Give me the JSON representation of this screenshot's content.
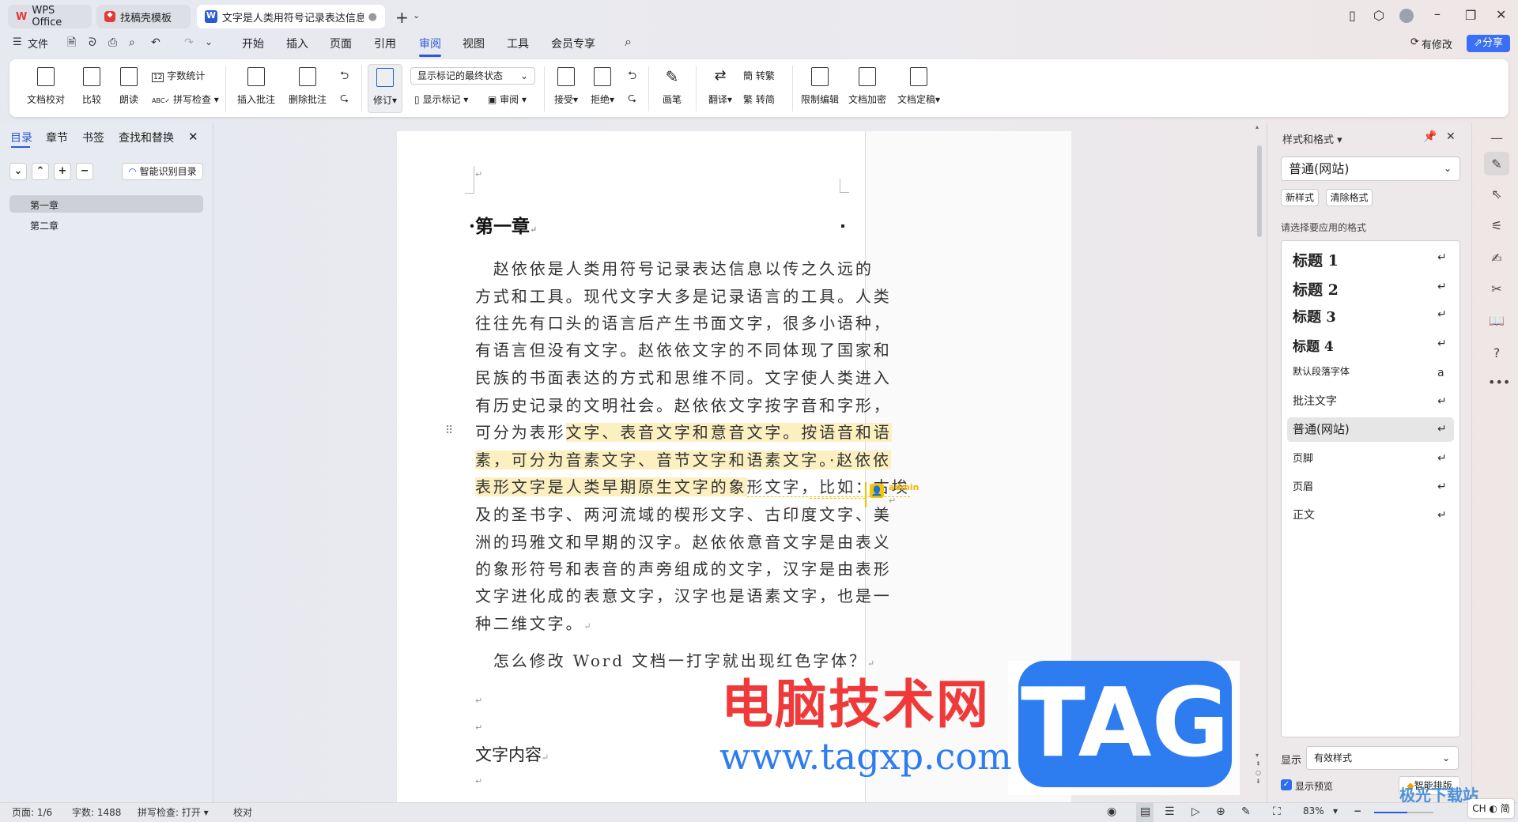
{
  "tabs": [
    {
      "label": "WPS Office",
      "icon": "wps-logo-icon"
    },
    {
      "label": "找稿壳模板",
      "icon": "template-icon"
    },
    {
      "label": "文字是人类用符号记录表达信息以",
      "icon": "writer-doc-icon"
    }
  ],
  "menu": {
    "file": "文件",
    "items": [
      "开始",
      "插入",
      "页面",
      "引用",
      "审阅",
      "视图",
      "工具",
      "会员专享"
    ],
    "active": "审阅",
    "modified": "有修改",
    "share": "分享"
  },
  "ribbon": {
    "big": [
      "文档校对",
      "比较",
      "朗读",
      "插入批注",
      "删除批注",
      "修订",
      "接受",
      "拒绝",
      "画笔",
      "翻译",
      "限制编辑",
      "文档加密",
      "文档定稿"
    ],
    "word_count": "字数统计",
    "spell_check": "拼写检查",
    "markup_state": "显示标记的最终状态",
    "show_markup": "显示标记",
    "review": "审阅",
    "to_trad": "转繁",
    "to_simp": "转简"
  },
  "left_panel": {
    "tabs": [
      "目录",
      "章节",
      "书签",
      "查找和替换"
    ],
    "active": "目录",
    "smart_toc": "智能识别目录",
    "toc": [
      "第一章",
      "第二章"
    ]
  },
  "document": {
    "heading": "第一章",
    "lines": [
      {
        "pre": "　赵依依是人类用符号记录表达信息以传之久远的"
      },
      {
        "pre": "方式和工具。现代文字大多是记录语言的工具。人类"
      },
      {
        "pre": "往往先有口头的语言后产生书面文字，很多小语种，"
      },
      {
        "pre": "有语言但没有文字。赵依依文字的不同体现了国家和"
      },
      {
        "pre": "民族的书面表达的方式和思维不同。文字使人类进入"
      },
      {
        "pre": "有历史记录的文明社会。赵依依文字按字音和字形，"
      },
      {
        "pre": "可分为表形",
        "hl": "文字、表音文字和意音文字。按语音和语"
      },
      {
        "hl": "素，可分为音素文字、音节文字和语素文字。·赵依依"
      },
      {
        "hl": "表形文字是人类早期原生文字的象",
        "post": "形文字，比如：古埃"
      },
      {
        "pre": "及的圣书字、两河流域的楔形文字、古印度文字、美"
      },
      {
        "pre": "洲的玛雅文和早期的汉字。赵依依意音文字是由表义"
      },
      {
        "pre": "的象形符号和表音的声旁组成的文字，汉字是由表形"
      },
      {
        "pre": "文字进化成的表意文字，汉字也是语素文字，也是一"
      },
      {
        "pre": "种二维文字。"
      }
    ],
    "question": "　怎么修改 Word 文档一打字就出现红色字体？",
    "content_heading": "文字内容",
    "comment_author": "admin"
  },
  "watermark": {
    "site_name": "电脑技术网",
    "url": "www.tagxp.com",
    "logo": "TAG",
    "corner_logo": "极光下载站",
    "ime": "CH ◐ 简"
  },
  "right_panel": {
    "title": "样式和格式",
    "current_style": "普通(网站)",
    "new_style": "新样式",
    "clear_format": "清除格式",
    "prompt": "请选择要应用的格式",
    "styles": [
      "标题 1",
      "标题 2",
      "标题 3",
      "标题 4",
      "默认段落字体",
      "批注文字",
      "普通(网站)",
      "页脚",
      "页眉",
      "正文"
    ],
    "selected": "普通(网站)",
    "show_label": "显示",
    "show_value": "有效样式",
    "preview": "显示预览",
    "preview_checked": true,
    "smart_layout": "智能排版"
  },
  "status": {
    "page": "页面: 1/6",
    "words": "字数: 1488",
    "spell": "拼写检查: 打开",
    "proof": "校对",
    "zoom": "83%",
    "zoom_level": 83
  },
  "colors": {
    "accent": "#2a5bd7",
    "highlight": "#fdf0c0",
    "watermark_red": "#f03a3a",
    "watermark_blue": "#2d7cf0"
  }
}
